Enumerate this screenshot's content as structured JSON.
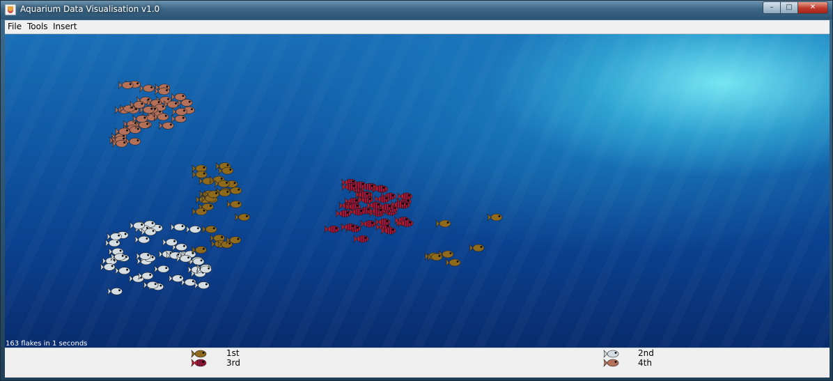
{
  "window": {
    "title": "Aquarium Data Visualisation v1.0"
  },
  "menu": {
    "items": [
      "File",
      "Tools",
      "Insert"
    ]
  },
  "status": {
    "text": "163 flakes in 1 seconds"
  },
  "legend": {
    "entries": [
      {
        "label": "1st",
        "fish": "orange-fish-icon"
      },
      {
        "label": "2nd",
        "fish": "grey-fish-icon"
      },
      {
        "label": "3rd",
        "fish": "red-striped-fish-icon"
      },
      {
        "label": "4th",
        "fish": "salmon-fish-icon"
      }
    ]
  },
  "colors": {
    "orange_fish": "#8f6a1c",
    "grey_fish": "#d3dde2",
    "red_fish": "#c0182b",
    "salmon_fish": "#b5705a",
    "ocean_top": "#1a6fb6",
    "ocean_bottom": "#082c6e"
  }
}
